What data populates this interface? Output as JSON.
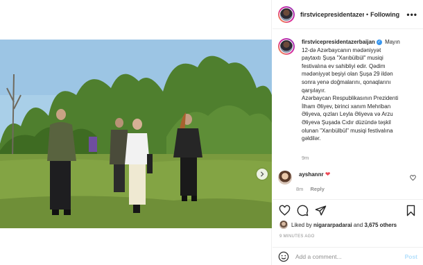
{
  "post": {
    "username": "firstvicepresidentazerbaijan",
    "header_username": "firstvicepresidentazerb",
    "follow_label": "Following",
    "more_label": "•••",
    "caption_lines": [
      "Mayın",
      "12-də Azərbaycanın mədəniyyət",
      "paytaxtı Şuşa \"Xarıbülbül\" musiqi",
      "festivalına ev sahibliyi edir. Qədim",
      "mədəniyyət beşiyi olan Şuşa 29 ildən",
      "sonra yenə doğmalarını, qonaqlarını",
      "qarşılayır.",
      "Azərbaycan Respublikasının Prezidenti",
      "İlham Əliyev, birinci xanım Mehriban",
      "Əliyeva, qızları Leyla Əliyeva və Arzu",
      "Əliyeva Şuşada Cıdır düzündə təşkil",
      "olunan \"Xarıbülbül\" musiqi festivalına",
      "gəldilər."
    ],
    "caption_time": "9m",
    "comment": {
      "username": "ayshannr",
      "heart": "❤",
      "time": "8m",
      "reply_label": "Reply"
    },
    "likes_prefix": "Liked by",
    "likes_user": "nigararpadarai",
    "likes_and": "and",
    "likes_count": "3,675 others",
    "time_ago": "9 MINUTES AGO",
    "add_comment_placeholder": "Add a comment...",
    "post_label": "Post"
  },
  "icons": {
    "verified": "verified-badge-icon",
    "like": "heart-outline-icon",
    "comment": "comment-bubble-icon",
    "share": "paper-plane-icon",
    "save": "bookmark-icon",
    "emoji": "smiley-icon",
    "next": "chevron-right-icon"
  }
}
